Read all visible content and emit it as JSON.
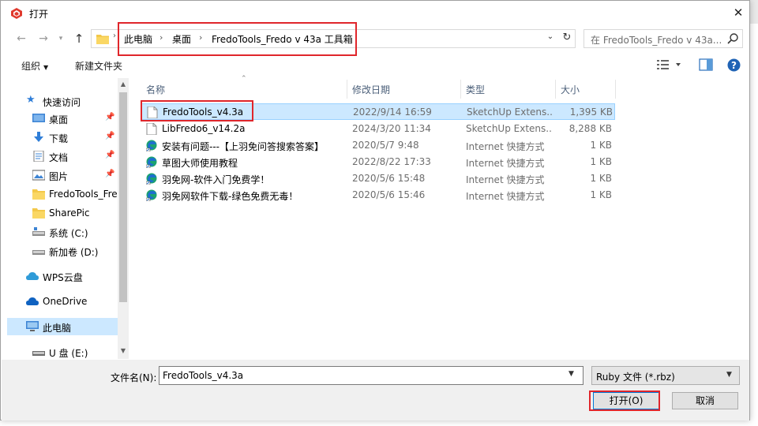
{
  "title": "打开",
  "address": {
    "crumbs": [
      "此电脑",
      "桌面",
      "FredoTools_Fredo v 43a 工具箱"
    ]
  },
  "search": {
    "placeholder": "在 FredoTools_Fredo v 43a..."
  },
  "toolbar": {
    "organize": "组织",
    "new_folder": "新建文件夹"
  },
  "nav": {
    "items": [
      {
        "label": "快速访问",
        "icon": "star-icon"
      },
      {
        "label": "桌面",
        "icon": "desktop-icon",
        "pinned": true
      },
      {
        "label": "下载",
        "icon": "download-icon",
        "pinned": true
      },
      {
        "label": "文档",
        "icon": "document-icon",
        "pinned": true
      },
      {
        "label": "图片",
        "icon": "picture-icon",
        "pinned": true
      },
      {
        "label": "FredoTools_Fre",
        "icon": "folder-icon"
      },
      {
        "label": "SharePic",
        "icon": "folder-icon"
      },
      {
        "label": "系统 (C:)",
        "icon": "drive-icon"
      },
      {
        "label": "新加卷 (D:)",
        "icon": "drive-icon"
      },
      {
        "label": "WPS云盘",
        "icon": "cloud-icon"
      },
      {
        "label": "OneDrive",
        "icon": "onedrive-icon"
      },
      {
        "label": "此电脑",
        "icon": "computer-icon",
        "selected": true
      },
      {
        "label": "U 盘 (E:)",
        "icon": "usb-drive-icon"
      }
    ]
  },
  "columns": {
    "name": "名称",
    "date": "修改日期",
    "type": "类型",
    "size": "大小"
  },
  "files": [
    {
      "name": "FredoTools_v4.3a",
      "date": "2022/9/14 16:59",
      "type": "SketchUp Extens...",
      "size": "1,395 KB",
      "icon": "file-icon",
      "selected": true
    },
    {
      "name": "LibFredo6_v14.2a",
      "date": "2024/3/20 11:34",
      "type": "SketchUp Extens...",
      "size": "8,288 KB",
      "icon": "file-icon"
    },
    {
      "name": "安装有问题---【上羽免问答搜索答案】",
      "date": "2020/5/7 9:48",
      "type": "Internet 快捷方式",
      "size": "1 KB",
      "icon": "edge-link-icon"
    },
    {
      "name": "草图大师使用教程",
      "date": "2022/8/22 17:33",
      "type": "Internet 快捷方式",
      "size": "1 KB",
      "icon": "edge-link-icon"
    },
    {
      "name": "羽免网-软件入门免费学！",
      "date": "2020/5/6 15:48",
      "type": "Internet 快捷方式",
      "size": "1 KB",
      "icon": "edge-link-icon"
    },
    {
      "name": "羽免网软件下载-绿色免费无毒！",
      "date": "2020/5/6 15:46",
      "type": "Internet 快捷方式",
      "size": "1 KB",
      "icon": "edge-link-icon"
    }
  ],
  "filename": {
    "label": "文件名(N):",
    "value": "FredoTools_v4.3a"
  },
  "filter": {
    "value": "Ruby 文件 (*.rbz)"
  },
  "buttons": {
    "open": "打开(O)",
    "cancel": "取消"
  },
  "colors": {
    "highlight": "#e0262b",
    "selection": "#cce8ff",
    "accent": "#0078d7"
  }
}
